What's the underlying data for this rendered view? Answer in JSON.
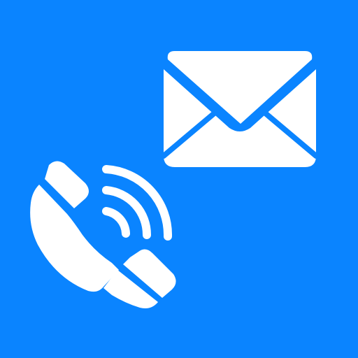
{
  "icon": {
    "background_color": "#0A84FF",
    "glyph_color": "#FFFFFF",
    "elements": [
      "envelope-icon",
      "phone-call-icon"
    ]
  }
}
